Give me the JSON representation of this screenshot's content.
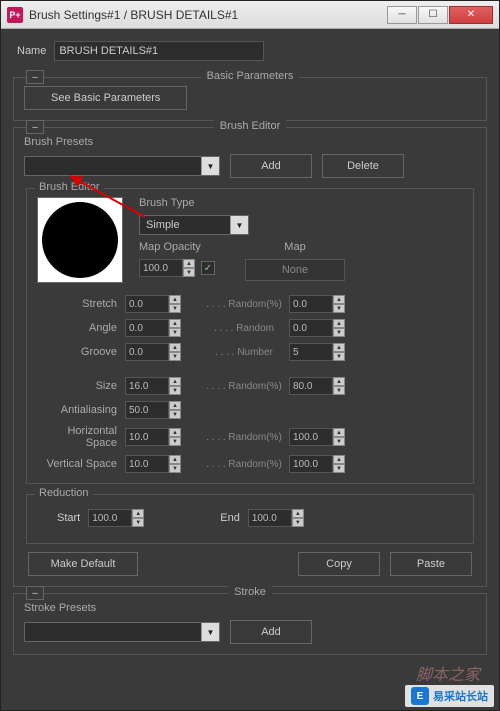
{
  "window": {
    "title": "Brush Settings#1 / BRUSH DETAILS#1"
  },
  "name": {
    "label": "Name",
    "value": "BRUSH DETAILS#1"
  },
  "basic": {
    "legend": "Basic Parameters",
    "see_btn": "See Basic Parameters"
  },
  "editor": {
    "legend": "Brush Editor",
    "presets_label": "Brush Presets",
    "preset_value": "",
    "add_btn": "Add",
    "delete_btn": "Delete",
    "inner_label": "Brush Editor",
    "brush_type_label": "Brush Type",
    "brush_type_value": "Simple",
    "map_opacity_label": "Map Opacity",
    "map_opacity_value": "100.0",
    "map_label": "Map",
    "map_btn": "None",
    "params": {
      "stretch": {
        "label": "Stretch",
        "value": "0.0",
        "rlabel": ". . . .  Random(%)",
        "rvalue": "0.0"
      },
      "angle": {
        "label": "Angle",
        "value": "0.0",
        "rlabel": ". . . .  Random",
        "rvalue": "0.0"
      },
      "groove": {
        "label": "Groove",
        "value": "0.0",
        "rlabel": ". . . .  Number",
        "rvalue": "5"
      },
      "size": {
        "label": "Size",
        "value": "16.0",
        "rlabel": ". . . .  Random(%)",
        "rvalue": "80.0"
      },
      "aa": {
        "label": "Antialiasing",
        "value": "50.0"
      },
      "hspace": {
        "label": "Horizontal Space",
        "value": "10.0",
        "rlabel": ". . . .  Random(%)",
        "rvalue": "100.0"
      },
      "vspace": {
        "label": "Vertical Space",
        "value": "10.0",
        "rlabel": ". . . .  Random(%)",
        "rvalue": "100.0"
      }
    }
  },
  "reduction": {
    "legend": "Reduction",
    "start_label": "Start",
    "start_value": "100.0",
    "end_label": "End",
    "end_value": "100.0"
  },
  "bottom": {
    "default_btn": "Make Default",
    "copy_btn": "Copy",
    "paste_btn": "Paste"
  },
  "stroke": {
    "legend": "Stroke",
    "presets_label": "Stroke Presets",
    "preset_value": "",
    "add_btn": "Add"
  },
  "watermark": {
    "cn": "脚本之家",
    "site": "易采站长站"
  }
}
